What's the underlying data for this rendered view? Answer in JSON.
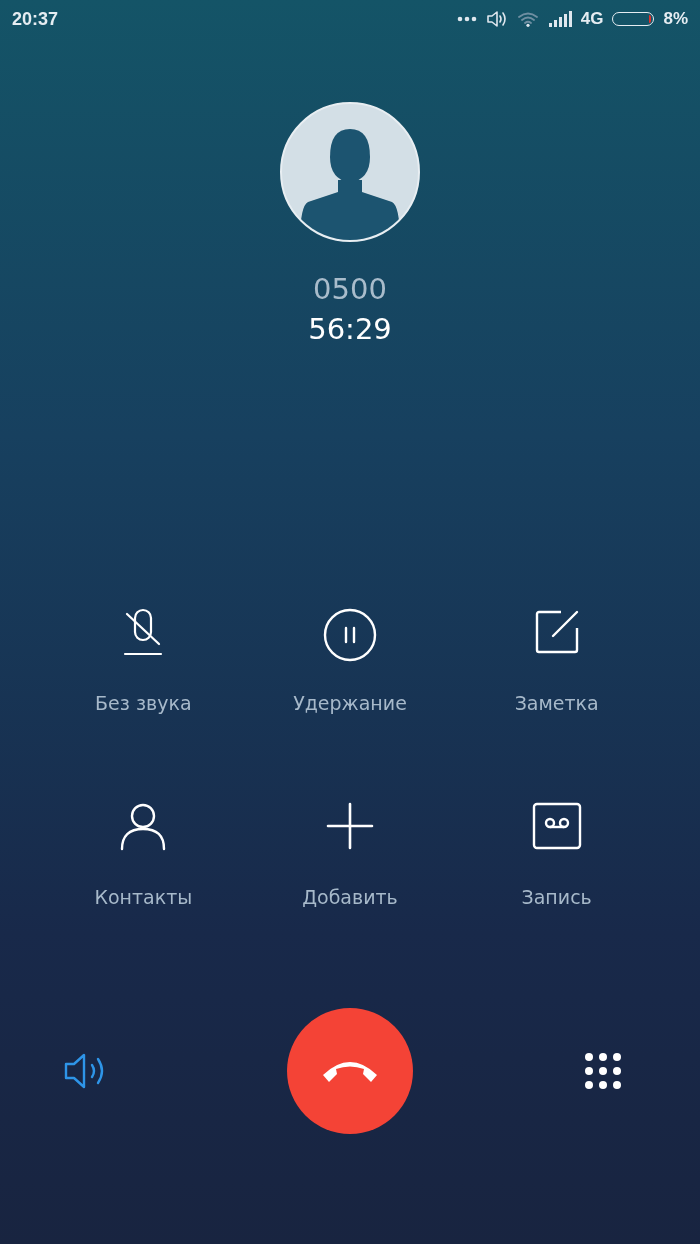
{
  "status_bar": {
    "time": "20:37",
    "network": "4G",
    "battery": {
      "level": 0.08,
      "text": "8%"
    }
  },
  "caller": {
    "number": "0500",
    "duration": "56:29"
  },
  "actions": [
    {
      "kind": "mute",
      "label": "Без звука"
    },
    {
      "kind": "hold",
      "label": "Удержание"
    },
    {
      "kind": "note",
      "label": "Заметка"
    },
    {
      "kind": "contacts",
      "label": "Контакты"
    },
    {
      "kind": "add",
      "label": "Добавить"
    },
    {
      "kind": "record",
      "label": "Запись"
    }
  ],
  "speaker": {
    "on": true
  }
}
